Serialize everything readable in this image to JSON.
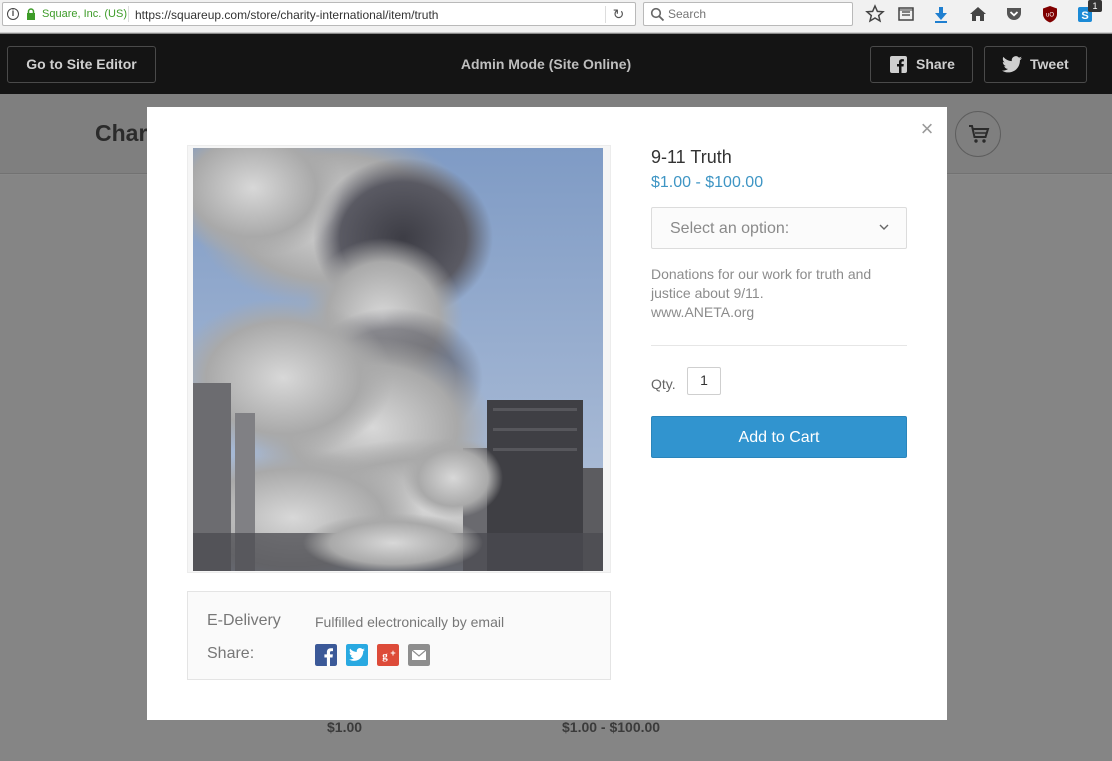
{
  "browser": {
    "identity": "Square, Inc. (US)",
    "url": "https://squareup.com/store/charity-international/item/truth",
    "search_placeholder": "Search",
    "badge_count": "1"
  },
  "adminbar": {
    "site_editor_label": "Go to Site Editor",
    "mode_text": "Admin Mode (Site Online)",
    "share_label": "Share",
    "tweet_label": "Tweet"
  },
  "background_page": {
    "store_name_fragment": "Char",
    "prices": [
      "$1.00",
      "$1.00 - $100.00"
    ]
  },
  "modal": {
    "close_symbol": "×",
    "product": {
      "title": "9-11 Truth",
      "price_range": "$1.00 - $100.00",
      "option_placeholder": "Select an option:",
      "description_lines": [
        "Donations for our work for truth and",
        "justice about 9/11.",
        "www.ANETA.org"
      ],
      "qty_label": "Qty.",
      "qty_value": "1",
      "add_to_cart_label": "Add to Cart"
    },
    "details": {
      "delivery_label": "E-Delivery",
      "delivery_value": "Fulfilled electronically by email",
      "share_label": "Share:",
      "share_icons": [
        "facebook-icon",
        "twitter-icon",
        "google-plus-icon",
        "email-icon"
      ]
    }
  },
  "colors": {
    "accent": "#3194cf",
    "price": "#3e95c4",
    "adminbar": "#141414"
  }
}
